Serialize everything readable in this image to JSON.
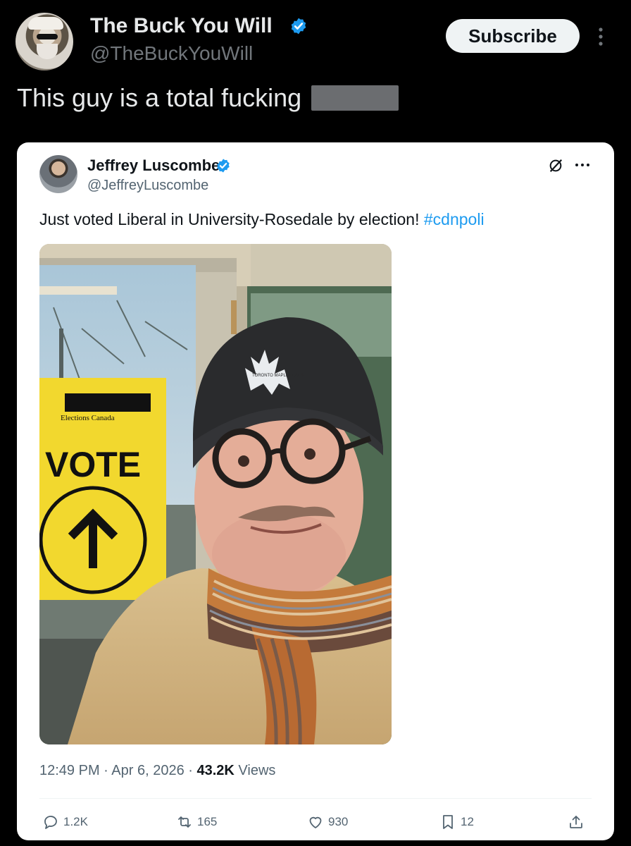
{
  "post": {
    "author_name": "The Buck You Will",
    "author_handle": "@TheBuckYouWill",
    "subscribe_label": "Subscribe",
    "text": "This guy is a total fucking"
  },
  "quoted_post": {
    "author_name": "Jeffrey Luscombe",
    "author_handle": "@JeffreyLuscombe",
    "text": "Just voted Liberal in University-Rosedale by election! ",
    "hashtag": "#cdnpoli",
    "photo": {
      "sign_org": "Elections Canada",
      "sign_word": "VOTE",
      "hat_logo": "TORONTO MAPLE LEAFS"
    },
    "time": "12:49 PM",
    "date": "Apr 6, 2026",
    "views_count": "43.2K",
    "views_label": "Views",
    "replies": "1.2K",
    "reposts": "165",
    "likes": "930",
    "bookmarks": "12"
  },
  "colors": {
    "background": "#000000",
    "card": "#ffffff",
    "link": "#1d9bf0",
    "verified": "#1d9bf0",
    "muted": "#536471"
  }
}
